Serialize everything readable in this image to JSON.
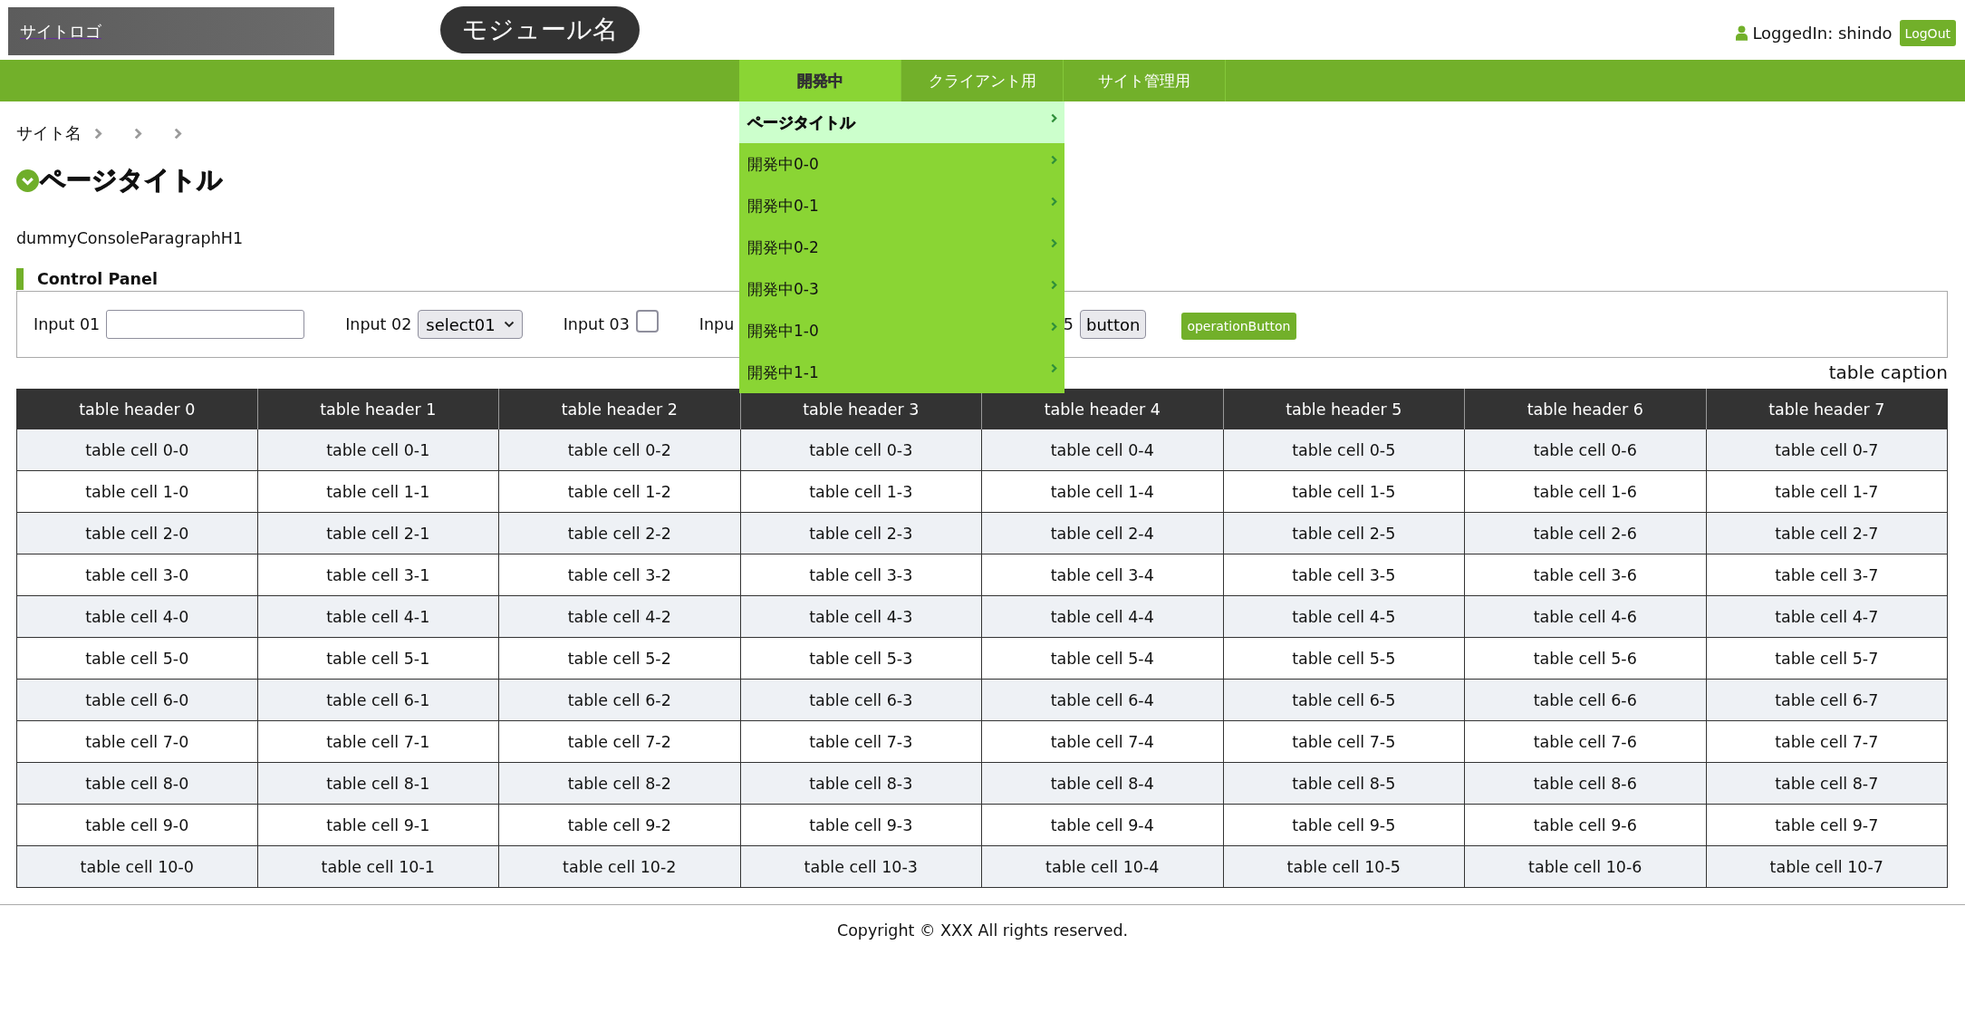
{
  "header": {
    "logo": "サイトロゴ",
    "module_name": "モジュール名",
    "user": "LoggedIn: shindo",
    "logout_button": "LogOut"
  },
  "nav": {
    "tabs": [
      {
        "label": "開発中",
        "selected": true,
        "menu": [
          {
            "label": "ページタイトル",
            "selected": true
          },
          {
            "label": "開発中0-0",
            "selected": false
          },
          {
            "label": "開発中0-1",
            "selected": false
          },
          {
            "label": "開発中0-2",
            "selected": false
          },
          {
            "label": "開発中0-3",
            "selected": false
          },
          {
            "label": "開発中1-0",
            "selected": false
          },
          {
            "label": "開発中1-1",
            "selected": false
          }
        ]
      },
      {
        "label": "クライアント用",
        "selected": false
      },
      {
        "label": "サイト管理用",
        "selected": false
      }
    ]
  },
  "breadcrumb": [
    {
      "kind": "link",
      "label": "サイト名"
    },
    {
      "kind": "blank"
    },
    {
      "kind": "blank"
    }
  ],
  "page": {
    "title": "ページタイトル",
    "paragraph": "dummyConsoleParagraphH1"
  },
  "control_panel": {
    "title": "Control Panel",
    "controls": [
      {
        "kind": "text",
        "label": "Input 01"
      },
      {
        "kind": "select",
        "label": "Input 02",
        "value": "select01"
      },
      {
        "kind": "checkbox",
        "label": "Input 03",
        "checked": false
      },
      {
        "kind": "covered",
        "label": "Inpu"
      },
      {
        "kind": "button",
        "label": "5",
        "button": "button"
      },
      {
        "kind": "action",
        "button": "operationButton"
      }
    ]
  },
  "table": {
    "caption": "table caption",
    "columns": [
      "table header 0",
      "table header 1",
      "table header 2",
      "table header 3",
      "table header 4",
      "table header 5",
      "table header 6",
      "table header 7"
    ],
    "rows": [
      [
        "table cell 0-0",
        "table cell 0-1",
        "table cell 0-2",
        "table cell 0-3",
        "table cell 0-4",
        "table cell 0-5",
        "table cell 0-6",
        "table cell 0-7"
      ],
      [
        "table cell 1-0",
        "table cell 1-1",
        "table cell 1-2",
        "table cell 1-3",
        "table cell 1-4",
        "table cell 1-5",
        "table cell 1-6",
        "table cell 1-7"
      ],
      [
        "table cell 2-0",
        "table cell 2-1",
        "table cell 2-2",
        "table cell 2-3",
        "table cell 2-4",
        "table cell 2-5",
        "table cell 2-6",
        "table cell 2-7"
      ],
      [
        "table cell 3-0",
        "table cell 3-1",
        "table cell 3-2",
        "table cell 3-3",
        "table cell 3-4",
        "table cell 3-5",
        "table cell 3-6",
        "table cell 3-7"
      ],
      [
        "table cell 4-0",
        "table cell 4-1",
        "table cell 4-2",
        "table cell 4-3",
        "table cell 4-4",
        "table cell 4-5",
        "table cell 4-6",
        "table cell 4-7"
      ],
      [
        "table cell 5-0",
        "table cell 5-1",
        "table cell 5-2",
        "table cell 5-3",
        "table cell 5-4",
        "table cell 5-5",
        "table cell 5-6",
        "table cell 5-7"
      ],
      [
        "table cell 6-0",
        "table cell 6-1",
        "table cell 6-2",
        "table cell 6-3",
        "table cell 6-4",
        "table cell 6-5",
        "table cell 6-6",
        "table cell 6-7"
      ],
      [
        "table cell 7-0",
        "table cell 7-1",
        "table cell 7-2",
        "table cell 7-3",
        "table cell 7-4",
        "table cell 7-5",
        "table cell 7-6",
        "table cell 7-7"
      ],
      [
        "table cell 8-0",
        "table cell 8-1",
        "table cell 8-2",
        "table cell 8-3",
        "table cell 8-4",
        "table cell 8-5",
        "table cell 8-6",
        "table cell 8-7"
      ],
      [
        "table cell 9-0",
        "table cell 9-1",
        "table cell 9-2",
        "table cell 9-3",
        "table cell 9-4",
        "table cell 9-5",
        "table cell 9-6",
        "table cell 9-7"
      ],
      [
        "table cell 10-0",
        "table cell 10-1",
        "table cell 10-2",
        "table cell 10-3",
        "table cell 10-4",
        "table cell 10-5",
        "table cell 10-6",
        "table cell 10-7"
      ]
    ]
  },
  "footer": {
    "copyright": "Copyright © XXX All rights reserved."
  }
}
